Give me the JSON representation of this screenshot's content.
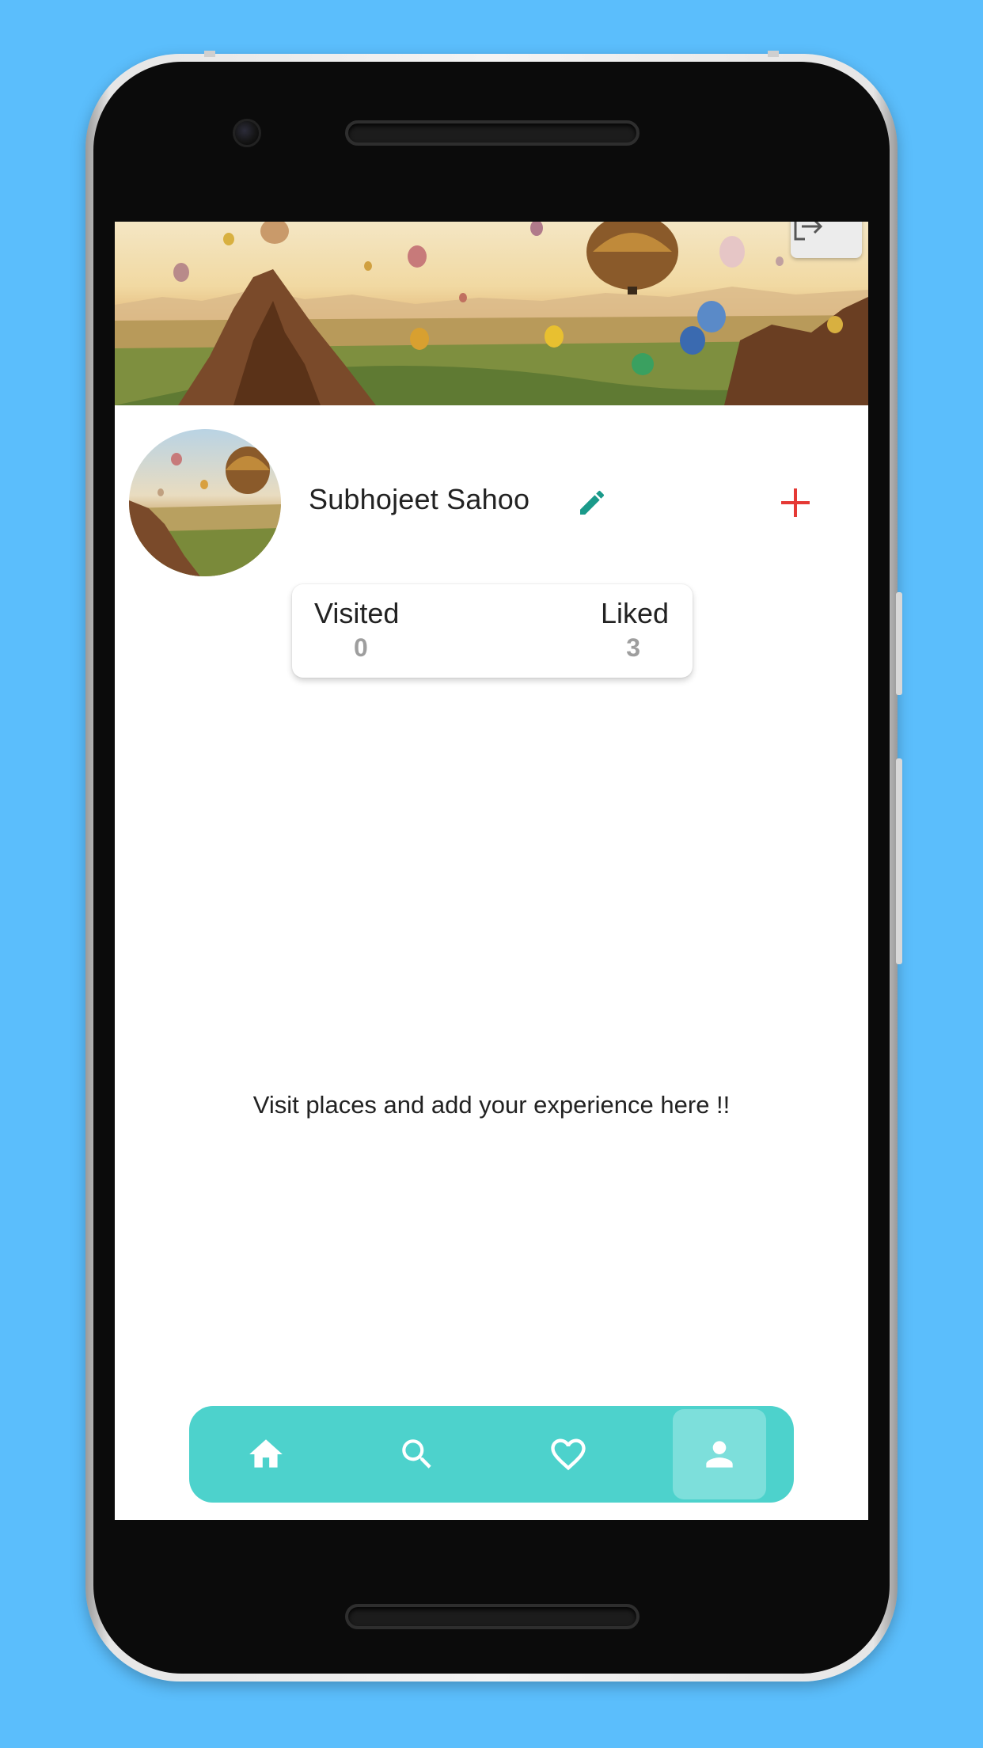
{
  "profile": {
    "name": "Subhojeet Sahoo"
  },
  "stats": {
    "visited_label": "Visited",
    "visited_value": "0",
    "liked_label": "Liked",
    "liked_value": "3"
  },
  "empty_message": "Visit places and add your experience here !!",
  "nav": {
    "items": [
      {
        "icon": "home-icon",
        "active": false
      },
      {
        "icon": "search-icon",
        "active": false
      },
      {
        "icon": "heart-icon",
        "active": false
      },
      {
        "icon": "person-icon",
        "active": true
      }
    ]
  },
  "colors": {
    "background": "#5bbefc",
    "nav_bar": "#4dd2cc",
    "nav_active": "#7ddfdb",
    "edit_icon": "#1a9a8a",
    "add_icon": "#e53935",
    "stat_value": "#9e9e9e"
  },
  "icons": {
    "logout": "logout-icon",
    "edit": "pencil-icon",
    "add": "plus-icon"
  }
}
